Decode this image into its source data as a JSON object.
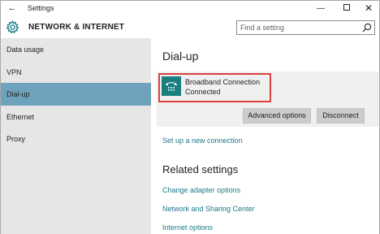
{
  "window": {
    "title": "Settings",
    "back_glyph": "←",
    "minimize_glyph": "—",
    "close_glyph": "✕"
  },
  "header": {
    "section_title": "NETWORK & INTERNET",
    "search_placeholder": "Find a setting"
  },
  "sidebar": {
    "items": [
      {
        "label": "Data usage",
        "active": false
      },
      {
        "label": "VPN",
        "active": false
      },
      {
        "label": "Dial-up",
        "active": true
      },
      {
        "label": "Ethernet",
        "active": false
      },
      {
        "label": "Proxy",
        "active": false
      }
    ]
  },
  "main": {
    "heading": "Dial-up",
    "connection": {
      "name": "Broadband Connection",
      "status": "Connected"
    },
    "buttons": {
      "advanced": "Advanced options",
      "disconnect": "Disconnect"
    },
    "setup_link": "Set up a new connection",
    "related_heading": "Related settings",
    "related_links": [
      "Change adapter options",
      "Network and Sharing Center",
      "Internet options"
    ]
  },
  "colors": {
    "accent": "#6fa2bd",
    "link": "#1a7a86",
    "highlight_border": "#d9413f",
    "connection_icon_bg": "#1a7f7f"
  },
  "icons": {
    "back": "back-arrow-icon",
    "gear": "gear-icon",
    "search": "search-icon",
    "connection": "dialup-phone-icon"
  }
}
